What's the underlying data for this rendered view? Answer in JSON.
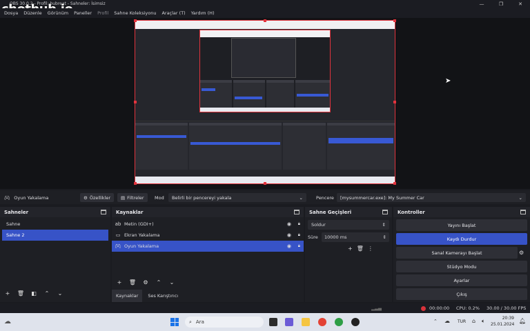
{
  "watermark": "chothub.io",
  "window": {
    "title": "OBS 30.0.2 - Profil: bubreat - Sahneler: İsimsiz",
    "minimize": "—",
    "maximize": "❐",
    "close": "✕"
  },
  "menu": [
    "Dosya",
    "Düzenle",
    "Görünüm",
    "Paneller",
    "Profil",
    "Sahne Koleksiyonu",
    "Araçlar (T)",
    "Yardım (H)"
  ],
  "source_bar": {
    "source_name": "Oyun Yakalama",
    "properties": "Özellikler",
    "filters": "Filtreler",
    "mode_label": "Mod",
    "mode_value": "Belirli bir pencereyi yakala",
    "window_label": "Pencere",
    "window_value": "[mysummercar.exe]: My Summer Car"
  },
  "scenes": {
    "title": "Sahneler",
    "items": [
      "Sahne",
      "Sahne 2"
    ],
    "selected_index": 1
  },
  "sources": {
    "title": "Kaynaklar",
    "items": [
      {
        "label": "Metin (GDI+)",
        "icon": "text-icon"
      },
      {
        "label": "Ekran Yakalama",
        "icon": "monitor-icon"
      },
      {
        "label": "Oyun Yakalama",
        "icon": "gamepad-icon"
      }
    ],
    "selected_index": 2,
    "tabs": [
      "Kaynaklar",
      "Ses Karıştırıcı"
    ]
  },
  "transitions": {
    "title": "Sahne Geçişleri",
    "type": "Soldur",
    "duration_label": "Süre",
    "duration": "10000 ms"
  },
  "controls": {
    "title": "Kontroller",
    "buttons": [
      "Yayını Başlat",
      "Kaydı Durdur",
      "Sanal Kamerayı Başlat",
      "Stüdyo Modu",
      "Ayarlar",
      "Çıkış"
    ],
    "active_index": 1
  },
  "status": {
    "rec_time": "00:00:00",
    "cpu": "CPU: 0.2%",
    "fps": "30.00 / 30.00 FPS"
  },
  "taskbar": {
    "search_placeholder": "Ara",
    "language": "TUR",
    "time": "20:39",
    "date": "25.01.2024"
  },
  "colors": {
    "accent": "#3753c7",
    "selection_border": "#e2333d",
    "panel_bg": "#1e1f24",
    "record_red": "#d8323a"
  }
}
